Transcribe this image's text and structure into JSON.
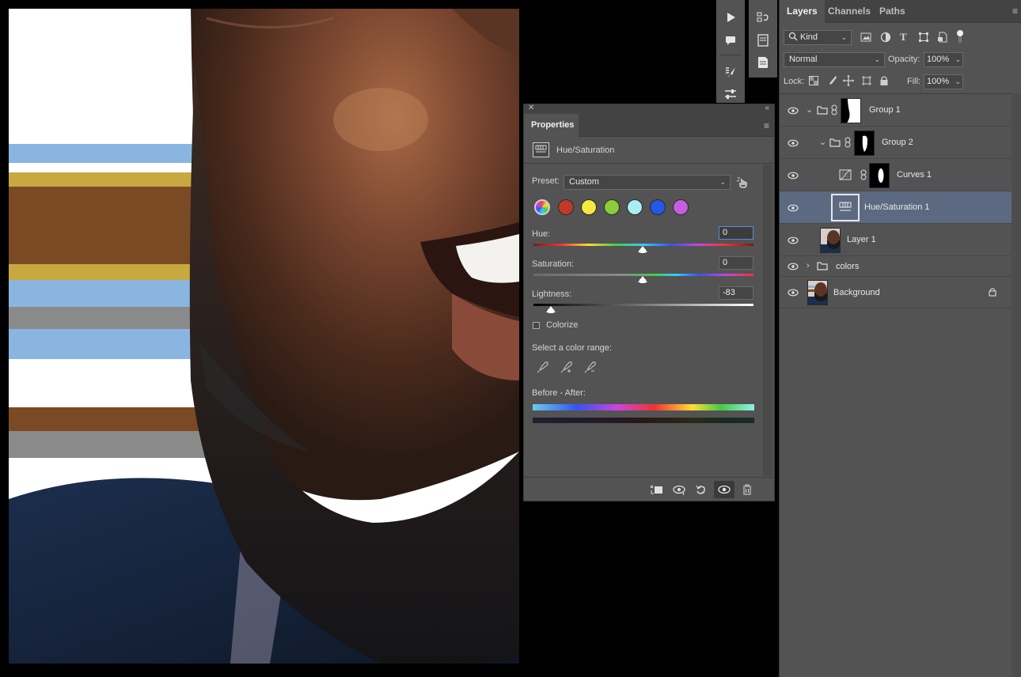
{
  "app": "Photoshop",
  "canvas": {
    "stripe_colors": {
      "blue": "#8ab5e0",
      "gold": "#c8a840",
      "brown": "#7a4a25",
      "gray": "#8a8a8a",
      "white": "#ffffff"
    },
    "content": "portrait crop with color stripes"
  },
  "tool_strip": {
    "items": [
      "play-icon",
      "comment-icon",
      "history-icon",
      "properties-icon",
      "notes-icon",
      "brush-settings-icon",
      "adjustments-icon"
    ]
  },
  "properties": {
    "tab_label": "Properties",
    "adjustment_name": "Hue/Saturation",
    "preset_label": "Preset:",
    "preset_value": "Custom",
    "channel_swatches": [
      "#8a8a8a",
      "#c0392b",
      "#f4e842",
      "#8ccc3a",
      "#a8eef2",
      "#2458e6",
      "#c75ee2"
    ],
    "hue_label": "Hue:",
    "hue_value": "0",
    "saturation_label": "Saturation:",
    "saturation_value": "0",
    "lightness_label": "Lightness:",
    "lightness_value": "-83",
    "colorize_label": "Colorize",
    "colorize_checked": false,
    "range_label": "Select a color range:",
    "before_after_label": "Before - After:",
    "slider_positions": {
      "hue": 0.5,
      "saturation": 0.5,
      "lightness": 0.085
    }
  },
  "layers_panel": {
    "tabs": [
      "Layers",
      "Channels",
      "Paths"
    ],
    "active_tab": "Layers",
    "filter_label": "Kind",
    "blend_mode": "Normal",
    "opacity_label": "Opacity:",
    "opacity_value": "100%",
    "lock_label": "Lock:",
    "fill_label": "Fill:",
    "fill_value": "100%",
    "layers": [
      {
        "name": "Group 1",
        "type": "group",
        "expanded": true,
        "selected": false
      },
      {
        "name": "Group 2",
        "type": "group",
        "expanded": true,
        "selected": false
      },
      {
        "name": "Curves 1",
        "type": "adjustment-curves",
        "selected": false
      },
      {
        "name": "Hue/Saturation 1",
        "type": "adjustment-hue",
        "selected": true
      },
      {
        "name": "Layer 1",
        "type": "image",
        "selected": false
      },
      {
        "name": "colors",
        "type": "group",
        "expanded": false,
        "selected": false
      },
      {
        "name": "Background",
        "type": "image",
        "locked": true,
        "selected": false
      }
    ]
  }
}
